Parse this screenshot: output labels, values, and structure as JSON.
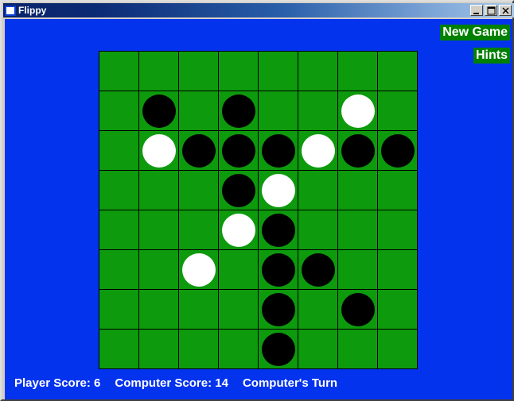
{
  "window": {
    "title": "Flippy",
    "icon": "window-icon",
    "controls": [
      {
        "name": "minimize-button",
        "label": "_"
      },
      {
        "name": "maximize-button",
        "label": "□"
      },
      {
        "name": "close-button",
        "label": "✕"
      }
    ]
  },
  "colors": {
    "background_blue": "#0433ee",
    "board_green": "#0d9a0d",
    "button_green": "#008000",
    "grid_line": "#000000",
    "disc_black": "#000000",
    "disc_white": "#ffffff",
    "text_white": "#ffffff"
  },
  "menu": {
    "new_game_label": "New Game",
    "hints_label": "Hints"
  },
  "status": {
    "player_score_label": "Player Score: 6",
    "computer_score_label": "Computer Score: 14",
    "turn_label": "Computer's Turn",
    "player_score": 6,
    "computer_score": 14,
    "turn": "Computer's Turn"
  },
  "board": {
    "rows": 8,
    "cols": 8,
    "cell_size": 50,
    "cells": [
      [
        "",
        "",
        "",
        "",
        "",
        "",
        "",
        ""
      ],
      [
        "",
        "black",
        "",
        "black",
        "",
        "",
        "white",
        ""
      ],
      [
        "",
        "white",
        "black",
        "black",
        "black",
        "white",
        "black",
        "black"
      ],
      [
        "",
        "",
        "",
        "black",
        "white",
        "",
        "",
        ""
      ],
      [
        "",
        "",
        "",
        "white",
        "black",
        "",
        "",
        ""
      ],
      [
        "",
        "",
        "white",
        "",
        "black",
        "black",
        "",
        ""
      ],
      [
        "",
        "",
        "",
        "",
        "black",
        "",
        "black",
        ""
      ],
      [
        "",
        "",
        "",
        "",
        "black",
        "",
        "",
        ""
      ]
    ]
  }
}
